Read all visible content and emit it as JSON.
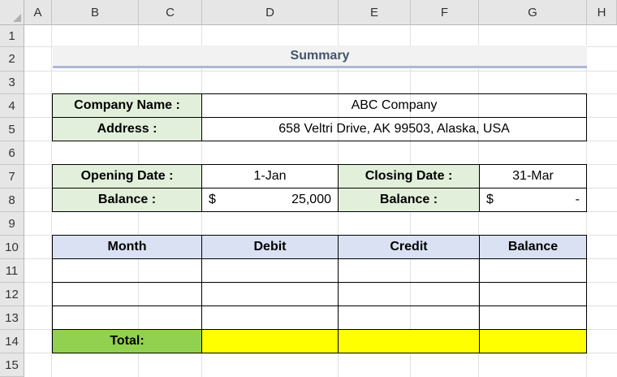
{
  "sheet": {
    "columns": [
      "A",
      "B",
      "C",
      "D",
      "E",
      "F",
      "G",
      "H"
    ],
    "rows": [
      "1",
      "2",
      "3",
      "4",
      "5",
      "6",
      "7",
      "8",
      "9",
      "10",
      "11",
      "12",
      "13",
      "14",
      "15"
    ]
  },
  "summary": {
    "title": "Summary"
  },
  "company": {
    "name_label": "Company Name :",
    "name_value": "ABC Company",
    "address_label": "Address :",
    "address_value": "658 Veltri Drive, AK 99503, Alaska, USA"
  },
  "period": {
    "opening_label": "Opening Date :",
    "opening_value": "1-Jan",
    "closing_label": "Closing Date :",
    "closing_value": "31-Mar",
    "balance_label": "Balance :",
    "opening_balance_currency": "$",
    "opening_balance_value": "25,000",
    "closing_balance_label": "Balance :",
    "closing_balance_currency": "$",
    "closing_balance_value": "-"
  },
  "ledger": {
    "headers": [
      "Month",
      "Debit",
      "Credit",
      "Balance"
    ],
    "total_label": "Total:"
  },
  "colors": {
    "label_fill": "#e2efda",
    "header_fill": "#d9e1f2",
    "total_fill": "#92d050",
    "yellow_fill": "#ffff00",
    "summary_text": "#44546a"
  }
}
